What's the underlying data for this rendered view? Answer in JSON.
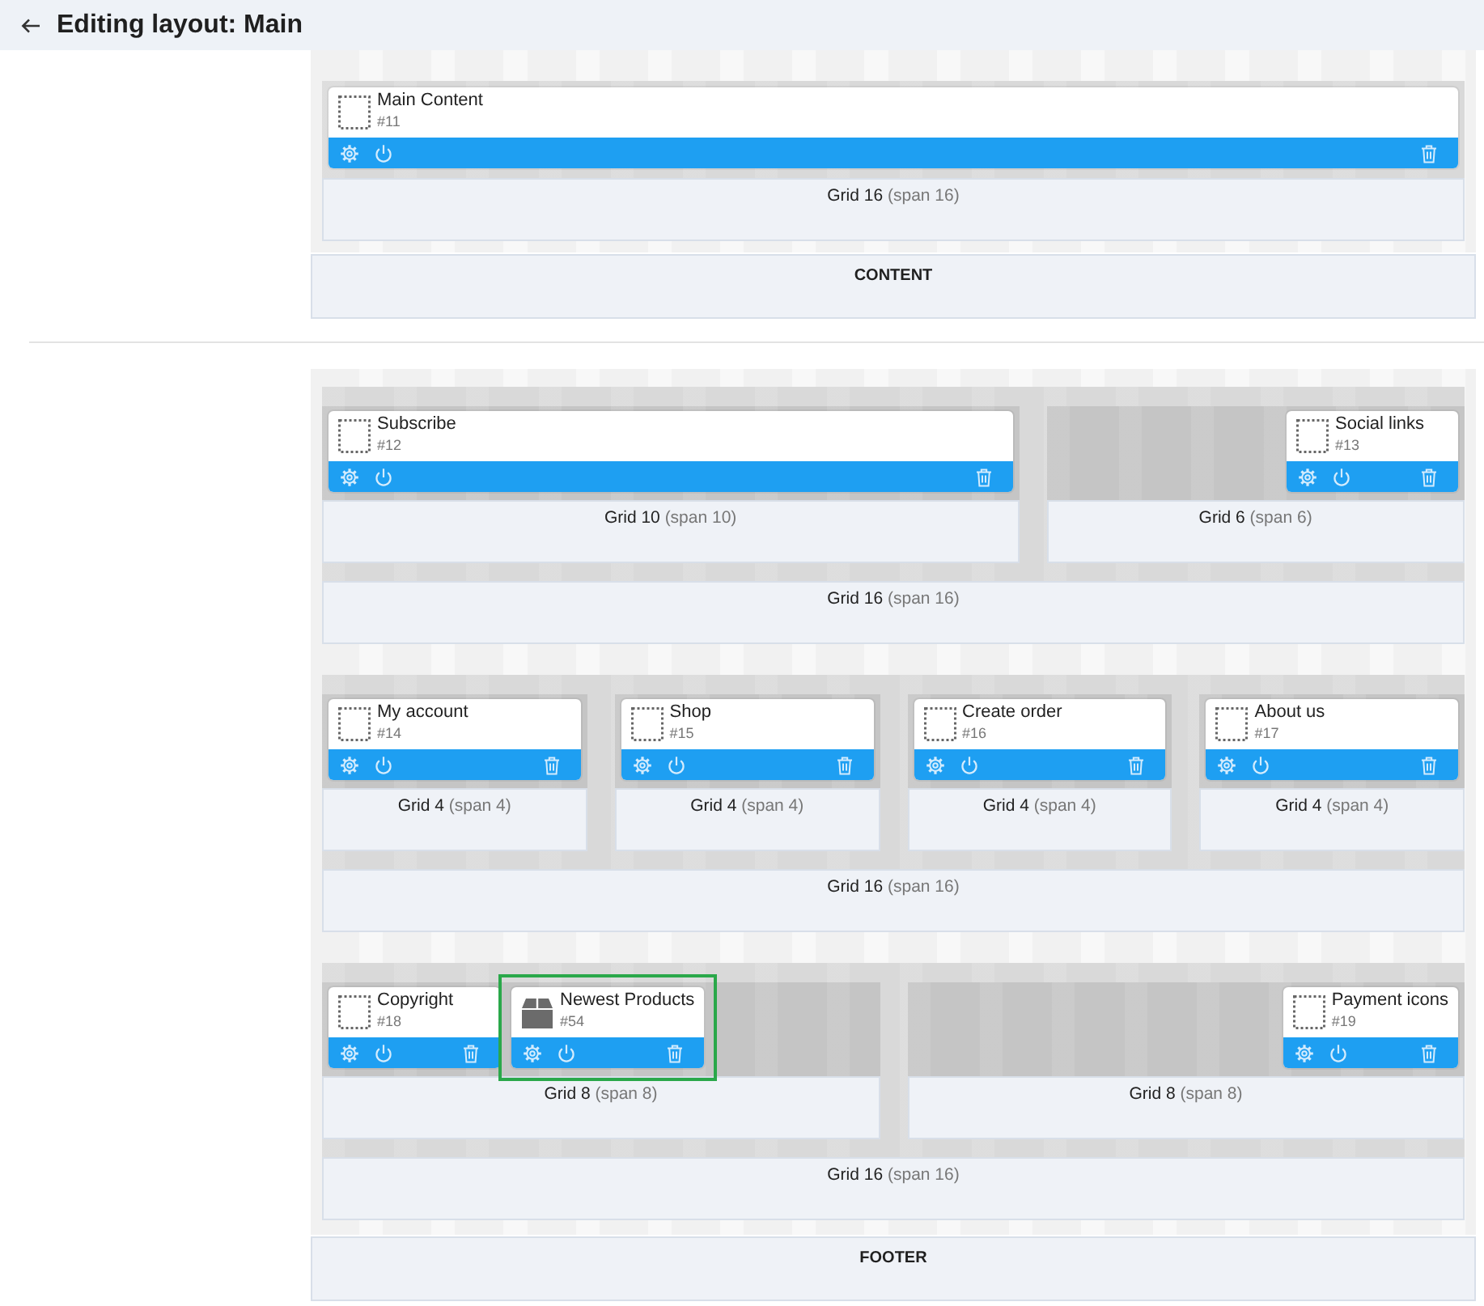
{
  "header": {
    "title": "Editing layout: Main"
  },
  "sections": [
    {
      "label": "CONTENT",
      "grids": [
        {
          "label": "Grid 16",
          "span": "(span 16)",
          "blocks": [
            {
              "kind": "empty",
              "name": "Main Content",
              "number": "#11",
              "full": true,
              "selected": false
            }
          ]
        }
      ]
    },
    {
      "label": "FOOTER",
      "grids": [
        {
          "label": "Grid 16",
          "span": "(span 16)",
          "children": [
            {
              "label": "Grid 10",
              "span": "(span 10)",
              "blocks": [
                {
                  "kind": "empty",
                  "name": "Subscribe",
                  "number": "#12",
                  "full": true,
                  "selected": false
                }
              ]
            },
            {
              "label": "Grid 6",
              "span": "(span 6)",
              "blocks": [
                {
                  "kind": "empty",
                  "name": "Social links",
                  "number": "#13",
                  "full": false,
                  "align_right": true,
                  "selected": false
                }
              ]
            }
          ]
        },
        {
          "label": "Grid 16",
          "span": "(span 16)",
          "children": [
            {
              "label": "Grid 4",
              "span": "(span 4)",
              "blocks": [
                {
                  "kind": "empty",
                  "name": "My account",
                  "number": "#14",
                  "full": true,
                  "selected": false
                }
              ]
            },
            {
              "label": "Grid 4",
              "span": "(span 4)",
              "blocks": [
                {
                  "kind": "empty",
                  "name": "Shop",
                  "number": "#15",
                  "full": true,
                  "selected": false
                }
              ]
            },
            {
              "label": "Grid 4",
              "span": "(span 4)",
              "blocks": [
                {
                  "kind": "empty",
                  "name": "Create order",
                  "number": "#16",
                  "full": true,
                  "selected": false
                }
              ]
            },
            {
              "label": "Grid 4",
              "span": "(span 4)",
              "blocks": [
                {
                  "kind": "empty",
                  "name": "About us",
                  "number": "#17",
                  "full": true,
                  "selected": false
                }
              ]
            }
          ]
        },
        {
          "label": "Grid 16",
          "span": "(span 16)",
          "children": [
            {
              "label": "Grid 8",
              "span": "(span 8)",
              "blocks": [
                {
                  "kind": "empty",
                  "name": "Copyright",
                  "number": "#18",
                  "full": false,
                  "align_right": false,
                  "selected": false
                },
                {
                  "kind": "product",
                  "name": "Newest Products",
                  "number": "#54",
                  "full": false,
                  "align_right": false,
                  "selected": true
                }
              ]
            },
            {
              "label": "Grid 8",
              "span": "(span 8)",
              "blocks": [
                {
                  "kind": "empty",
                  "name": "Payment icons",
                  "number": "#19",
                  "full": false,
                  "align_right": true,
                  "selected": false
                }
              ]
            }
          ]
        }
      ]
    }
  ]
}
